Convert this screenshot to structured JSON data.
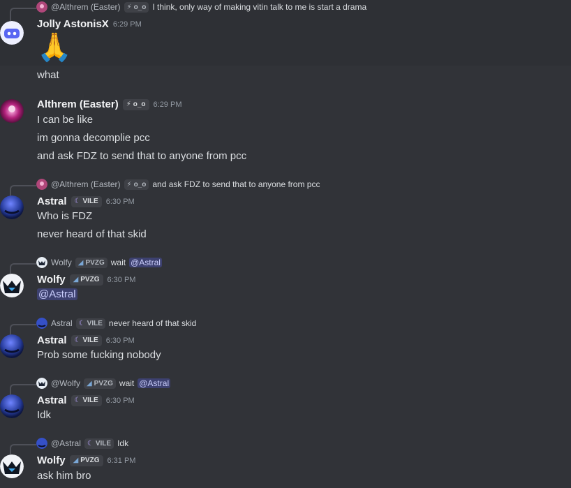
{
  "colors": {
    "background": "#313338",
    "highlight": "#2e3035",
    "mention_bg": "#5865f2",
    "name": "#f2f3f5",
    "text": "#dbdee1",
    "muted": "#949ba4"
  },
  "messages": [
    {
      "reply": {
        "user": "@Althrem (Easter)",
        "tag_icon": "lightning-icon",
        "tag": "o_o",
        "text": "I think, only way of making vitin talk to me is start a drama"
      },
      "user": "Jolly AstonisX",
      "time": "6:29 PM",
      "emoji": "🙏",
      "lines": [
        "what"
      ]
    },
    {
      "user": "Althrem (Easter)",
      "tag_icon": "lightning-icon",
      "tag": "o_o",
      "time": "6:29 PM",
      "lines": [
        "I can be like",
        "im gonna decomplie pcc",
        "and ask FDZ to send that to anyone from pcc"
      ]
    },
    {
      "reply": {
        "user": "@Althrem (Easter)",
        "tag_icon": "lightning-icon",
        "tag": "o_o",
        "text": "and ask FDZ to send that to anyone from pcc"
      },
      "user": "Astral",
      "tag_icon": "crescent-icon",
      "tag": "VILE",
      "time": "6:30 PM",
      "lines": [
        "Who is FDZ",
        "never heard of that skid"
      ]
    },
    {
      "reply": {
        "user": "Wolfy",
        "tag_icon": "leaf-icon",
        "tag": "PVZG",
        "text": "wait",
        "mention": "@Astral"
      },
      "user": "Wolfy",
      "tag_icon": "leaf-icon",
      "tag": "PVZG",
      "time": "6:30 PM",
      "mention_line": "@Astral"
    },
    {
      "reply": {
        "user": "Astral",
        "tag_icon": "crescent-icon",
        "tag": "VILE",
        "text": "never heard of that skid"
      },
      "user": "Astral",
      "tag_icon": "crescent-icon",
      "tag": "VILE",
      "time": "6:30 PM",
      "lines": [
        "Prob some fucking nobody"
      ]
    },
    {
      "reply": {
        "user": "@Wolfy",
        "tag_icon": "leaf-icon",
        "tag": "PVZG",
        "text": "wait",
        "mention": "@Astral"
      },
      "user": "Astral",
      "tag_icon": "crescent-icon",
      "tag": "VILE",
      "time": "6:30 PM",
      "lines": [
        "Idk"
      ]
    },
    {
      "reply": {
        "user": "@Astral",
        "tag_icon": "crescent-icon",
        "tag": "VILE",
        "text": "Idk"
      },
      "user": "Wolfy",
      "tag_icon": "leaf-icon",
      "tag": "PVZG",
      "time": "6:31 PM",
      "lines": [
        "ask him bro"
      ]
    }
  ]
}
